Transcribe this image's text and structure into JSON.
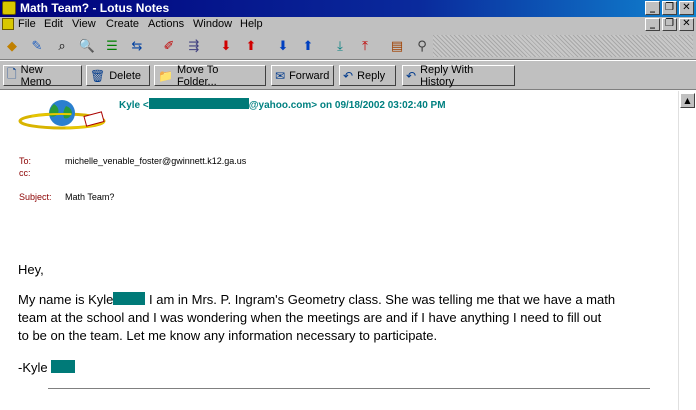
{
  "window": {
    "title": "Math Team? - Lotus Notes"
  },
  "menu": [
    "File",
    "Edit",
    "View",
    "Create",
    "Actions",
    "Window",
    "Help"
  ],
  "toolbar_icons": [
    "open-icon",
    "edit-icon",
    "find-icon",
    "search-icon",
    "categorize-icon",
    "move-icon",
    "italic-icon",
    "forward-icon",
    "down-arrow-icon",
    "up-arrow-icon",
    "next-down-icon",
    "next-up-icon",
    "unread-down-icon",
    "unread-up-icon",
    "outline-icon",
    "link-icon",
    "format-icon",
    "bookmark-icon"
  ],
  "actions": {
    "new_memo": "New Memo",
    "delete": "Delete",
    "move_to_folder": "Move To Folder...",
    "forward": "Forward",
    "reply": "Reply",
    "reply_with_history": "Reply With History"
  },
  "memo": {
    "from_prefix": "Kyle <",
    "from_suffix": "@yahoo.com> on 09/18/2002 03:02:40 PM",
    "to_label": "To:",
    "to": "michelle_venable_foster@gwinnett.k12.ga.us",
    "cc_label": "cc:",
    "subject_label": "Subject:",
    "subject": "Math Team?",
    "greeting": "Hey,",
    "line1a": "My name is Kyle",
    "line1b": " I am in Mrs. P. Ingram's Geometry class.  She was telling me that we have a math",
    "line2": "team at the school and I was wondering when the meetings are and if I have anything I need to fill out",
    "line3": "to be on the team.  Let me know any information necessary to participate.",
    "signoff": "-Kyle"
  }
}
